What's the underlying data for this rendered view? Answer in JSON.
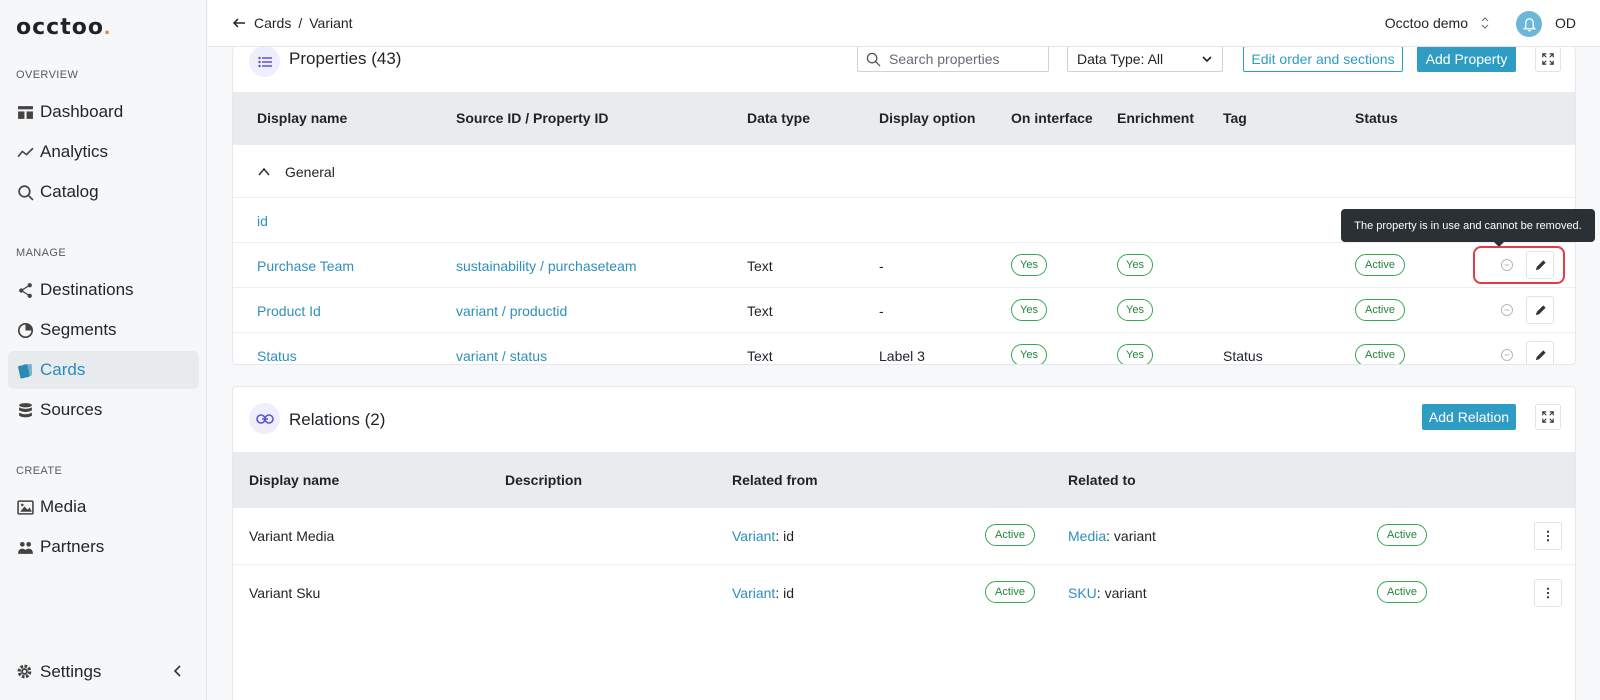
{
  "brand": {
    "logo_text": "occtoo",
    "logo_dot": ".",
    "accent": "#2f9cc4",
    "active_green": "#34a853",
    "highlight_red": "#e53a45"
  },
  "sidebar": {
    "sections": [
      {
        "label": "OVERVIEW"
      },
      {
        "label": "MANAGE"
      },
      {
        "label": "CREATE"
      }
    ],
    "items": [
      {
        "label": "Dashboard",
        "icon": "dashboard-icon"
      },
      {
        "label": "Analytics",
        "icon": "analytics-icon"
      },
      {
        "label": "Catalog",
        "icon": "search-icon"
      },
      {
        "label": "Destinations",
        "icon": "share-icon"
      },
      {
        "label": "Segments",
        "icon": "pie-icon"
      },
      {
        "label": "Cards",
        "icon": "cards-icon",
        "active": true
      },
      {
        "label": "Sources",
        "icon": "database-icon"
      },
      {
        "label": "Media",
        "icon": "image-icon"
      },
      {
        "label": "Partners",
        "icon": "people-icon"
      }
    ],
    "settings_label": "Settings"
  },
  "topbar": {
    "breadcrumb": [
      "Cards",
      "Variant"
    ],
    "separator": "/",
    "org": "Occtoo demo",
    "user_initials": "OD"
  },
  "properties": {
    "title": "Properties (43)",
    "search_placeholder": "Search properties",
    "data_type_filter": "Data Type: All",
    "edit_order_label": "Edit order and sections",
    "add_label": "Add Property",
    "columns": [
      "Display name",
      "Source ID / Property ID",
      "Data type",
      "Display option",
      "On interface",
      "Enrichment",
      "Tag",
      "Status"
    ],
    "group": "General",
    "rows": [
      {
        "name": "id"
      },
      {
        "name": "Purchase Team",
        "source": "sustainability / purchaseteam",
        "type": "Text",
        "display": "-",
        "on_interface": "Yes",
        "enrichment": "Yes",
        "tag": "",
        "status": "Active"
      },
      {
        "name": "Product Id",
        "source": "variant / productid",
        "type": "Text",
        "display": "-",
        "on_interface": "Yes",
        "enrichment": "Yes",
        "tag": "",
        "status": "Active"
      },
      {
        "name": "Status",
        "source": "variant / status",
        "type": "Text",
        "display": "Label 3",
        "on_interface": "Yes",
        "enrichment": "Yes",
        "tag": "Status",
        "status": "Active"
      }
    ],
    "tooltip": "The property is in use and cannot be removed."
  },
  "relations": {
    "title": "Relations (2)",
    "add_label": "Add Relation",
    "columns": [
      "Display name",
      "Description",
      "Related from",
      "Related to"
    ],
    "rows": [
      {
        "name": "Variant Media",
        "from_link": "Variant",
        "from_field": ": id",
        "from_status": "Active",
        "to_link": "Media",
        "to_field": ": variant",
        "to_status": "Active"
      },
      {
        "name": "Variant Sku",
        "from_link": "Variant",
        "from_field": ": id",
        "from_status": "Active",
        "to_link": "SKU",
        "to_field": ": variant",
        "to_status": "Active"
      }
    ]
  }
}
